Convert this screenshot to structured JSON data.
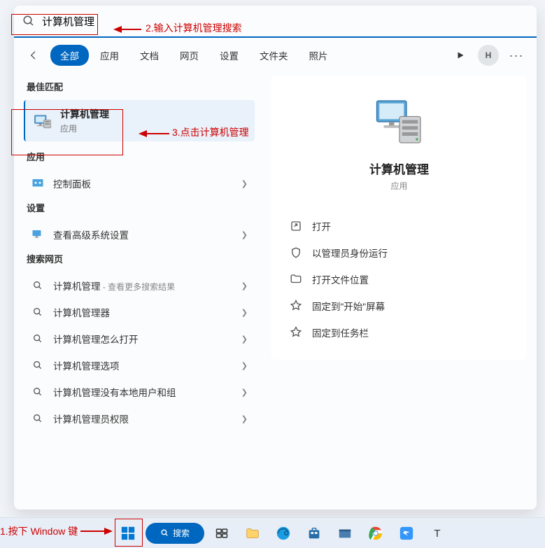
{
  "search": {
    "value": "计算机管理"
  },
  "tabs": [
    "全部",
    "应用",
    "文档",
    "网页",
    "设置",
    "文件夹",
    "照片"
  ],
  "active_tab": 0,
  "avatar_letter": "H",
  "left": {
    "best_match_header": "最佳匹配",
    "best_match": {
      "title": "计算机管理",
      "subtitle": "应用"
    },
    "apps_header": "应用",
    "apps": [
      {
        "label": "控制面板"
      }
    ],
    "settings_header": "设置",
    "settings": [
      {
        "label": "查看高级系统设置"
      }
    ],
    "web_header": "搜索网页",
    "web": [
      {
        "label": "计算机管理",
        "sub": " - 查看更多搜索结果"
      },
      {
        "label": "计算机管理器",
        "sub": ""
      },
      {
        "label": "计算机管理怎么打开",
        "sub": ""
      },
      {
        "label": "计算机管理选项",
        "sub": ""
      },
      {
        "label": "计算机管理没有本地用户和组",
        "sub": ""
      },
      {
        "label": "计算机管理员权限",
        "sub": ""
      }
    ]
  },
  "detail": {
    "title": "计算机管理",
    "subtitle": "应用",
    "actions": [
      {
        "icon": "open",
        "label": "打开"
      },
      {
        "icon": "admin",
        "label": "以管理员身份运行"
      },
      {
        "icon": "folder",
        "label": "打开文件位置"
      },
      {
        "icon": "pin",
        "label": "固定到\"开始\"屏幕"
      },
      {
        "icon": "pin",
        "label": "固定到任务栏"
      }
    ]
  },
  "annotations": {
    "step1": "1.按下 Window 键",
    "step2": "2.输入计算机管理搜索",
    "step3": "3.点击计算机管理"
  },
  "taskbar": {
    "search_label": "搜索"
  }
}
